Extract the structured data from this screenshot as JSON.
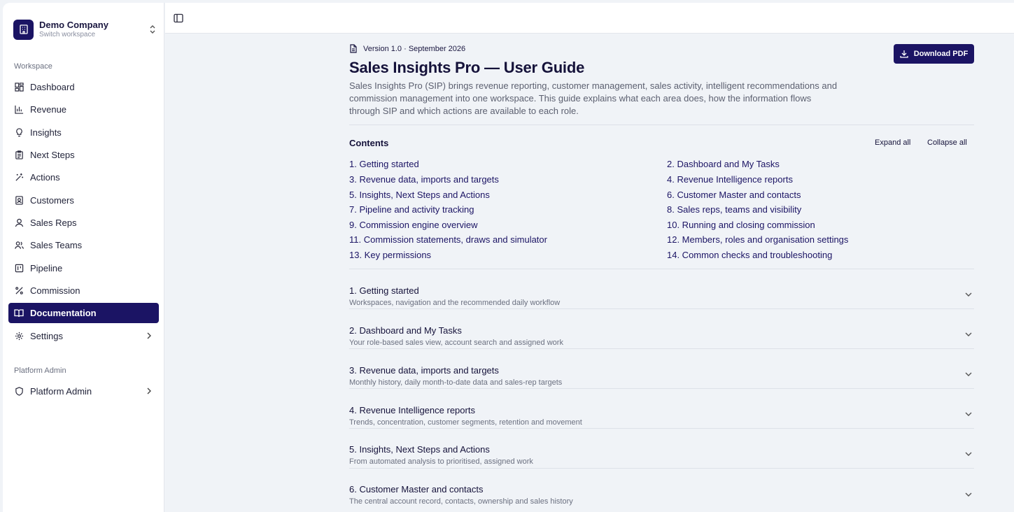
{
  "workspace": {
    "name": "Demo Company",
    "subtitle": "Switch workspace"
  },
  "sidebar": {
    "workspace_group": "Workspace",
    "items": [
      {
        "label": "Dashboard",
        "icon": "dashboard-icon"
      },
      {
        "label": "Revenue",
        "icon": "bar-chart-icon"
      },
      {
        "label": "Insights",
        "icon": "lightbulb-icon"
      },
      {
        "label": "Next Steps",
        "icon": "clipboard-icon"
      },
      {
        "label": "Actions",
        "icon": "wand-icon"
      },
      {
        "label": "Customers",
        "icon": "contact-card-icon"
      },
      {
        "label": "Sales Reps",
        "icon": "user-icon"
      },
      {
        "label": "Sales Teams",
        "icon": "users-icon"
      },
      {
        "label": "Pipeline",
        "icon": "kanban-icon"
      },
      {
        "label": "Commission",
        "icon": "percent-icon"
      },
      {
        "label": "Documentation",
        "icon": "book-icon",
        "active": true
      },
      {
        "label": "Settings",
        "icon": "gear-icon"
      }
    ],
    "admin_group": "Platform Admin",
    "admin_item": {
      "label": "Platform Admin",
      "icon": "shield-icon"
    }
  },
  "doc": {
    "version": "Version 1.0 · September 2026",
    "title": "Sales Insights Pro — User Guide",
    "intro": "Sales Insights Pro (SIP) brings revenue reporting, customer management, sales activity, intelligent recommendations and commission management into one workspace. This guide explains what each area does, how the information flows through SIP and which actions are available to each role.",
    "download_label": "Download PDF",
    "contents_label": "Contents",
    "expand_all": "Expand all",
    "collapse_all": "Collapse all",
    "toc": [
      "1. Getting started",
      "2. Dashboard and My Tasks",
      "3. Revenue data, imports and targets",
      "4. Revenue Intelligence reports",
      "5. Insights, Next Steps and Actions",
      "6. Customer Master and contacts",
      "7. Pipeline and activity tracking",
      "8. Sales reps, teams and visibility",
      "9. Commission engine overview",
      "10. Running and closing commission",
      "11. Commission statements, draws and simulator",
      "12. Members, roles and organisation settings",
      "13. Key permissions",
      "14. Common checks and troubleshooting"
    ],
    "sections": [
      {
        "title": "1. Getting started",
        "subtitle": "Workspaces, navigation and the recommended daily workflow"
      },
      {
        "title": "2. Dashboard and My Tasks",
        "subtitle": "Your role-based sales view, account search and assigned work"
      },
      {
        "title": "3. Revenue data, imports and targets",
        "subtitle": "Monthly history, daily month-to-date data and sales-rep targets"
      },
      {
        "title": "4. Revenue Intelligence reports",
        "subtitle": "Trends, concentration, customer segments, retention and movement"
      },
      {
        "title": "5. Insights, Next Steps and Actions",
        "subtitle": "From automated analysis to prioritised, assigned work"
      },
      {
        "title": "6. Customer Master and contacts",
        "subtitle": "The central account record, contacts, ownership and sales history"
      }
    ]
  },
  "colors": {
    "primary": "#1b1464",
    "background": "#f0f3f7"
  }
}
